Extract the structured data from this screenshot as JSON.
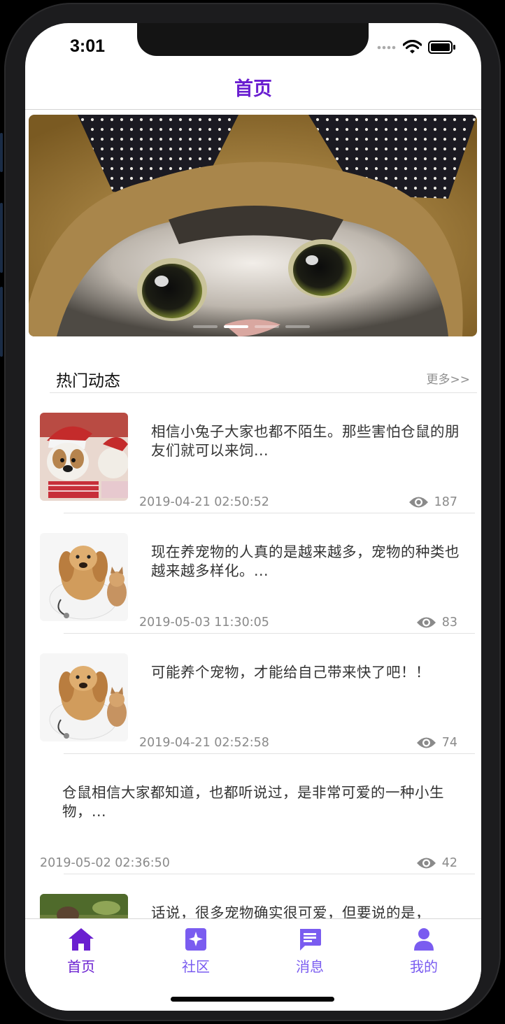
{
  "status_bar": {
    "time": "3:01"
  },
  "nav": {
    "title": "首页"
  },
  "banner": {
    "slides": 4,
    "active_slide": 2
  },
  "section": {
    "title": "热门动态",
    "more": "更多>>"
  },
  "posts": [
    {
      "title": "相信小兔子大家也都不陌生。那些害怕仓鼠的朋友们就可以来饲...",
      "date": "2019-04-21 02:50:52",
      "views": "187",
      "thumb": "puppies"
    },
    {
      "title": "现在养宠物的人真的是越来越多，宠物的种类也越来越多样化。...",
      "date": "2019-05-03 11:30:05",
      "views": "83",
      "thumb": "dog-cat"
    },
    {
      "title": "可能养个宠物，才能给自己带来快了吧！！",
      "date": "2019-04-21 02:52:58",
      "views": "74",
      "thumb": "dog-cat"
    },
    {
      "title": "仓鼠相信大家都知道，也都听说过，是非常可爱的一种小生物，...",
      "date": "2019-05-02 02:36:50",
      "views": "42",
      "thumb": ""
    },
    {
      "title": "话说，很多宠物确实很可爱，但要说的是，",
      "date": "",
      "views": "",
      "thumb": "outdoor"
    }
  ],
  "tabs": [
    {
      "label": "首页",
      "icon": "home-icon",
      "active": true
    },
    {
      "label": "社区",
      "icon": "community-icon",
      "active": false
    },
    {
      "label": "消息",
      "icon": "message-icon",
      "active": false
    },
    {
      "label": "我的",
      "icon": "profile-icon",
      "active": false
    }
  ],
  "colors": {
    "accent": "#6a1fd0",
    "tab_icon": "#7a5cf0",
    "meta_text": "#8a8a8a"
  }
}
